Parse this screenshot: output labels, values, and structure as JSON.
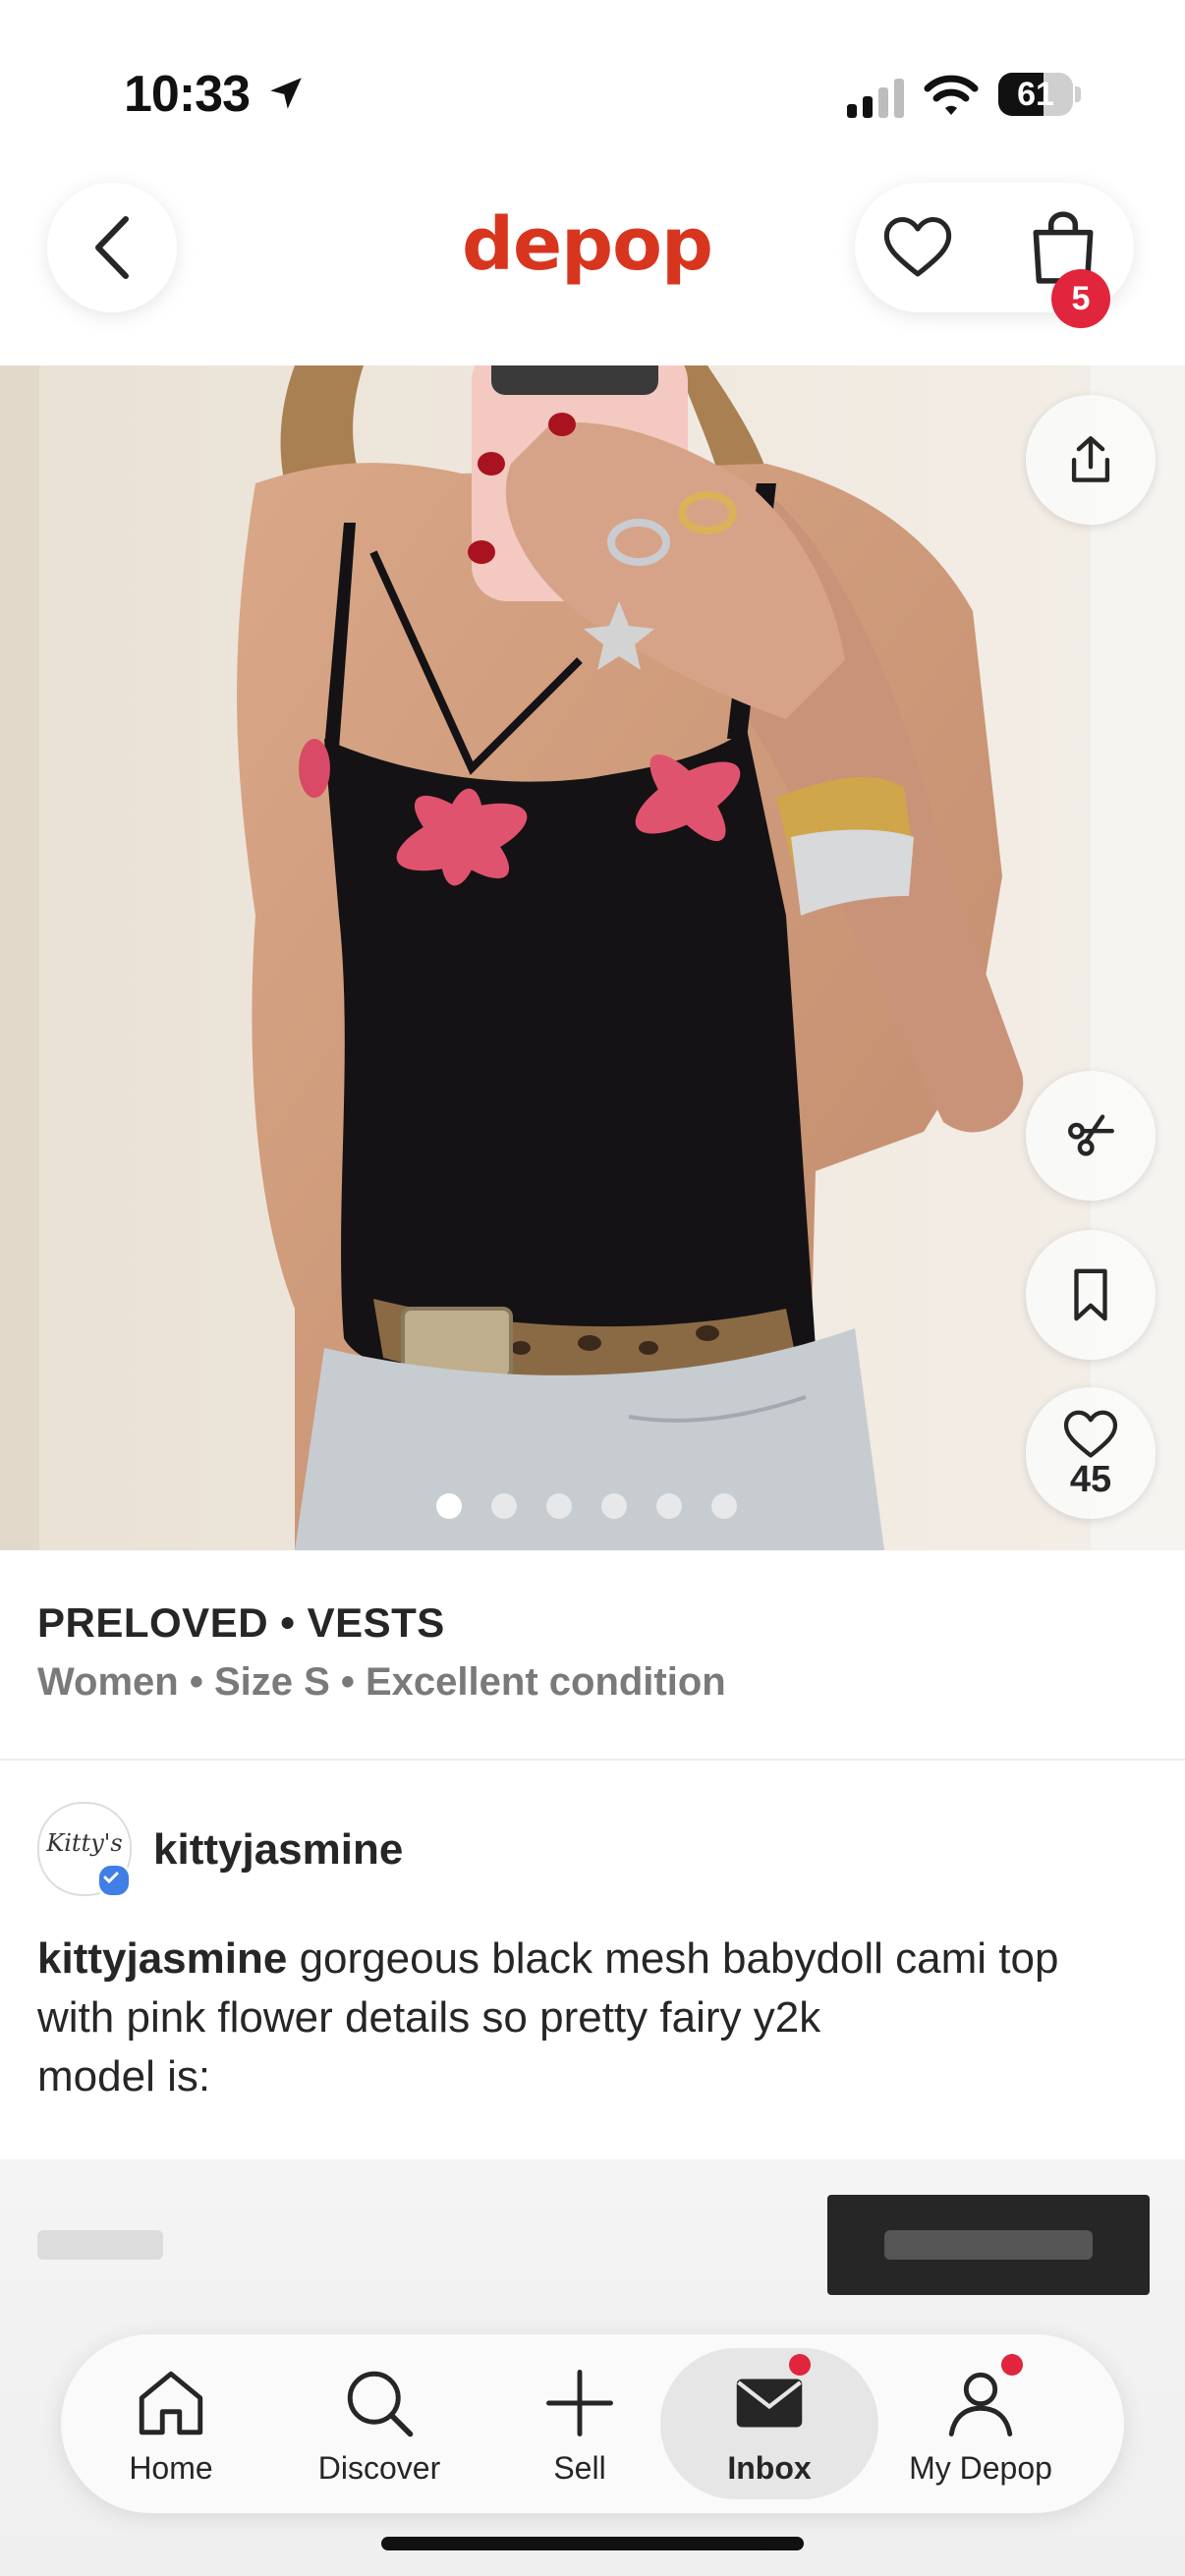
{
  "status_bar": {
    "time": "10:33",
    "battery": "61",
    "battery_level": 0.61
  },
  "header": {
    "logo": "depop",
    "bag_count": "5",
    "icons": [
      "back-icon",
      "heart-icon",
      "bag-icon"
    ]
  },
  "photo": {
    "like_count": "45",
    "image_count": 6,
    "active_index": 0,
    "icons": [
      "share-icon",
      "offer-icon",
      "bookmark-icon",
      "heart-icon"
    ]
  },
  "listing": {
    "category": "PRELOVED • VESTS",
    "attributes": "Women • Size S • Excellent condition",
    "seller": "kittyjasmine",
    "avatar_text": "Kitty's",
    "description_user": "kittyjasmine",
    "description_text": " gorgeous black mesh babydoll cami top with pink flower details so pretty fairy y2k\nmodel is:"
  },
  "tabs": [
    {
      "label": "Home",
      "icon": "home-icon"
    },
    {
      "label": "Discover",
      "icon": "search-icon"
    },
    {
      "label": "Sell",
      "icon": "plus-icon"
    },
    {
      "label": "Inbox",
      "icon": "mail-icon",
      "active": true,
      "notification": true
    },
    {
      "label": "My Depop",
      "icon": "person-icon",
      "notification": true
    }
  ],
  "colors": {
    "brand": "#d8351f",
    "badge": "#e0253d",
    "text": "#262626",
    "muted": "#7a7a7a"
  }
}
